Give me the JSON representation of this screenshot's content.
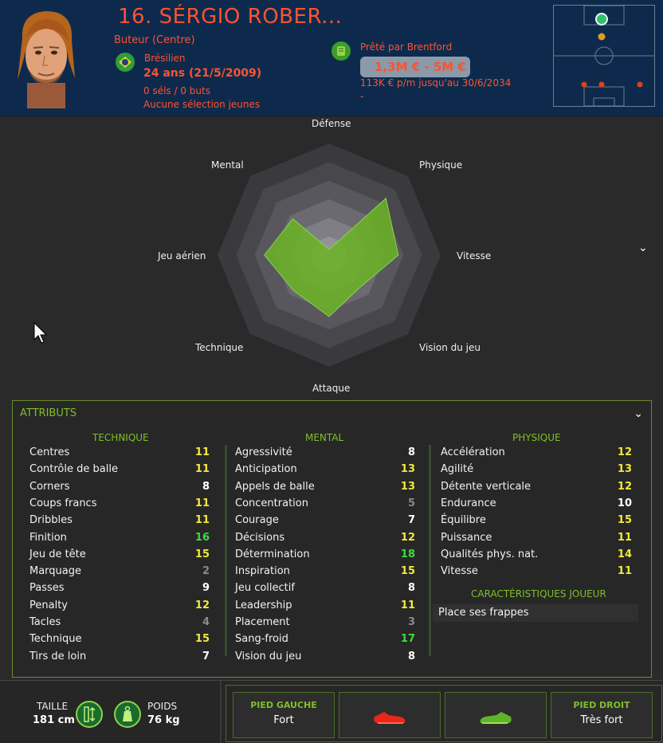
{
  "header": {
    "name": "16. SÉRGIO ROBER...",
    "role": "Buteur (Centre)",
    "nationality": "Brésilien",
    "age": "24 ans (21/5/2009)",
    "caps": "0 séls / 0 buts",
    "youth": "Aucune sélection jeunes",
    "loan": "Prêté par Brentford",
    "value": "1,3M € - 5M €",
    "wage": "113K € p/m jusqu'au 30/6/2034",
    "wage_extra": "-"
  },
  "radar": {
    "labels": {
      "defense": "Défense",
      "physique": "Physique",
      "vitesse": "Vitesse",
      "vision": "Vision du jeu",
      "attaque": "Attaque",
      "technique": "Technique",
      "jeu_aerien": "Jeu aérien",
      "mental": "Mental"
    },
    "values": [
      0.05,
      0.72,
      0.62,
      0.4,
      0.55,
      0.45,
      0.58,
      0.46
    ],
    "fill_color": "#6bb324"
  },
  "attributes": {
    "title": "ATTRIBUTS",
    "technique": {
      "heading": "TECHNIQUE",
      "rows": [
        {
          "name": "Centres",
          "value": "11"
        },
        {
          "name": "Contrôle de balle",
          "value": "11"
        },
        {
          "name": "Corners",
          "value": "8"
        },
        {
          "name": "Coups francs",
          "value": "11"
        },
        {
          "name": "Dribbles",
          "value": "11"
        },
        {
          "name": "Finition",
          "value": "16"
        },
        {
          "name": "Jeu de tête",
          "value": "15"
        },
        {
          "name": "Marquage",
          "value": "2"
        },
        {
          "name": "Passes",
          "value": "9"
        },
        {
          "name": "Penalty",
          "value": "12"
        },
        {
          "name": "Tacles",
          "value": "4"
        },
        {
          "name": "Technique",
          "value": "15"
        },
        {
          "name": "Tirs de loin",
          "value": "7"
        }
      ]
    },
    "mental": {
      "heading": "MENTAL",
      "rows": [
        {
          "name": "Agressivité",
          "value": "8"
        },
        {
          "name": "Anticipation",
          "value": "13"
        },
        {
          "name": "Appels de balle",
          "value": "13"
        },
        {
          "name": "Concentration",
          "value": "5"
        },
        {
          "name": "Courage",
          "value": "7"
        },
        {
          "name": "Décisions",
          "value": "12"
        },
        {
          "name": "Détermination",
          "value": "18"
        },
        {
          "name": "Inspiration",
          "value": "15"
        },
        {
          "name": "Jeu collectif",
          "value": "8"
        },
        {
          "name": "Leadership",
          "value": "11"
        },
        {
          "name": "Placement",
          "value": "3"
        },
        {
          "name": "Sang-froid",
          "value": "17"
        },
        {
          "name": "Vision du jeu",
          "value": "8"
        }
      ]
    },
    "physique": {
      "heading": "PHYSIQUE",
      "rows": [
        {
          "name": "Accélération",
          "value": "12"
        },
        {
          "name": "Agilité",
          "value": "13"
        },
        {
          "name": "Détente verticale",
          "value": "12"
        },
        {
          "name": "Endurance",
          "value": "10"
        },
        {
          "name": "Équilibre",
          "value": "15"
        },
        {
          "name": "Puissance",
          "value": "11"
        },
        {
          "name": "Qualités phys. nat.",
          "value": "14"
        },
        {
          "name": "Vitesse",
          "value": "11"
        }
      ]
    },
    "traits_heading": "CARACTÉRISTIQUES JOUEUR",
    "traits": [
      "Place ses frappes"
    ]
  },
  "colors": {
    "high": "#3ddc3d",
    "good": "#f2e83a",
    "mid": "#ffffff",
    "low": "#8a8a8a",
    "accent": "#ff5230"
  },
  "bottom": {
    "height_label": "TAILLE",
    "height_value": "181 cm",
    "weight_label": "POIDS",
    "weight_value": "76 kg",
    "left_foot_label": "PIED GAUCHE",
    "left_foot_value": "Fort",
    "right_foot_label": "PIED DROIT",
    "right_foot_value": "Très fort"
  }
}
